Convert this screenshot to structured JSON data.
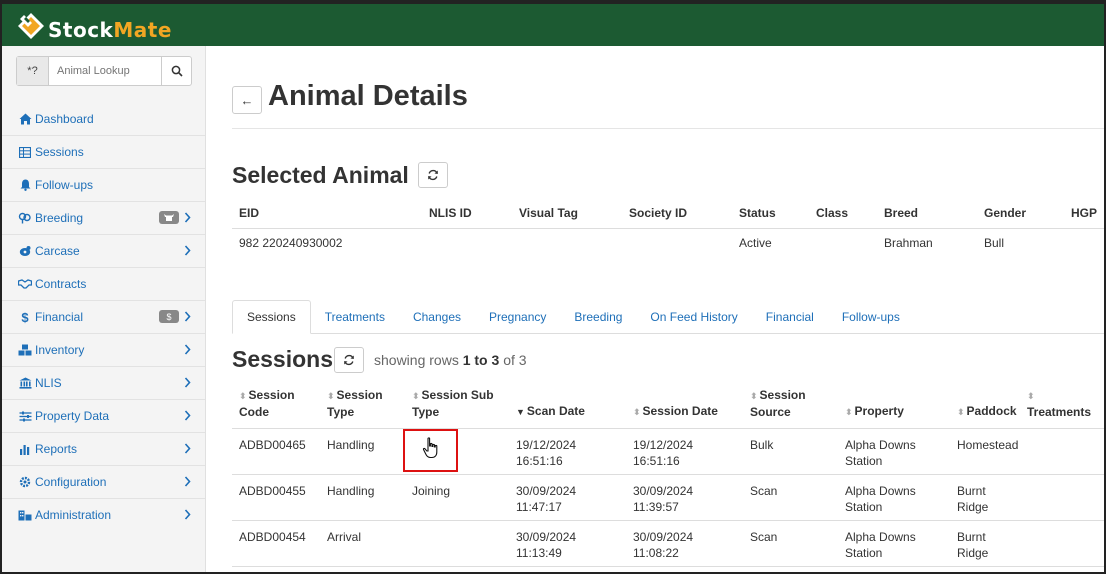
{
  "app": {
    "logo_part1": "Stock",
    "logo_part2": "Mate",
    "brand_color": "#1c5a32",
    "accent_color": "#f2a623"
  },
  "search": {
    "wildcard_label": "*?",
    "placeholder": "Animal Lookup",
    "icon": "search-icon"
  },
  "sidebar": {
    "items": [
      {
        "label": "Dashboard",
        "icon": "home-icon"
      },
      {
        "label": "Sessions",
        "icon": "table-icon"
      },
      {
        "label": "Follow-ups",
        "icon": "bell-icon"
      },
      {
        "label": "Breeding",
        "icon": "gender-icon",
        "badge_icon": "cow-icon"
      },
      {
        "label": "Carcase",
        "icon": "carcase-icon"
      },
      {
        "label": "Contracts",
        "icon": "handshake-icon"
      },
      {
        "label": "Financial",
        "icon": "dollar-icon",
        "badge": "$"
      },
      {
        "label": "Inventory",
        "icon": "boxes-icon"
      },
      {
        "label": "NLIS",
        "icon": "bank-icon"
      },
      {
        "label": "Property Data",
        "icon": "sliders-icon"
      },
      {
        "label": "Reports",
        "icon": "bar-chart-icon"
      },
      {
        "label": "Configuration",
        "icon": "cog-icon"
      },
      {
        "label": "Administration",
        "icon": "admin-icon"
      }
    ]
  },
  "page": {
    "title": "Animal Details",
    "back_label": "←"
  },
  "selected_animal": {
    "heading": "Selected Animal",
    "columns": [
      "EID",
      "NLIS ID",
      "Visual Tag",
      "Society ID",
      "Status",
      "Class",
      "Breed",
      "Gender",
      "HGP"
    ],
    "row": [
      "982 220240930002",
      "",
      "",
      "",
      "Active",
      "",
      "Brahman",
      "Bull",
      ""
    ]
  },
  "tabs": [
    "Sessions",
    "Treatments",
    "Changes",
    "Pregnancy",
    "Breeding",
    "On Feed History",
    "Financial",
    "Follow-ups"
  ],
  "sessions": {
    "heading": "Sessions",
    "showing_prefix": "showing rows",
    "showing_range": "1 to 3",
    "showing_suffix": "of 3",
    "columns": [
      {
        "line1": "Session",
        "line2": "Code"
      },
      {
        "line1": "Session",
        "line2": "Type"
      },
      {
        "line1": "Session Sub",
        "line2": "Type"
      },
      {
        "line1": "",
        "line2": "Scan Date"
      },
      {
        "line1": "",
        "line2": "Session Date"
      },
      {
        "line1": "Session",
        "line2": "Source"
      },
      {
        "line1": "",
        "line2": "Property"
      },
      {
        "line1": "",
        "line2": "Paddock"
      },
      {
        "line1": "",
        "line2": "Treatments"
      }
    ],
    "rows": [
      {
        "code": "ADBD00465",
        "type": "Handling",
        "sub_type": "",
        "scan_date": "19/12/2024",
        "scan_time": "16:51:16",
        "session_date": "19/12/2024",
        "session_time": "16:51:16",
        "source": "Bulk",
        "property1": "Alpha Downs",
        "property2": "Station",
        "paddock1": "Homestead",
        "paddock2": "",
        "treatments": ""
      },
      {
        "code": "ADBD00455",
        "type": "Handling",
        "sub_type": "Joining",
        "scan_date": "30/09/2024",
        "scan_time": "11:47:17",
        "session_date": "30/09/2024",
        "session_time": "11:39:57",
        "source": "Scan",
        "property1": "Alpha Downs",
        "property2": "Station",
        "paddock1": "Burnt",
        "paddock2": "Ridge",
        "treatments": ""
      },
      {
        "code": "ADBD00454",
        "type": "Arrival",
        "sub_type": "",
        "scan_date": "30/09/2024",
        "scan_time": "11:13:49",
        "session_date": "30/09/2024",
        "session_time": "11:08:22",
        "source": "Scan",
        "property1": "Alpha Downs",
        "property2": "Station",
        "paddock1": "Burnt",
        "paddock2": "Ridge",
        "treatments": ""
      }
    ]
  }
}
